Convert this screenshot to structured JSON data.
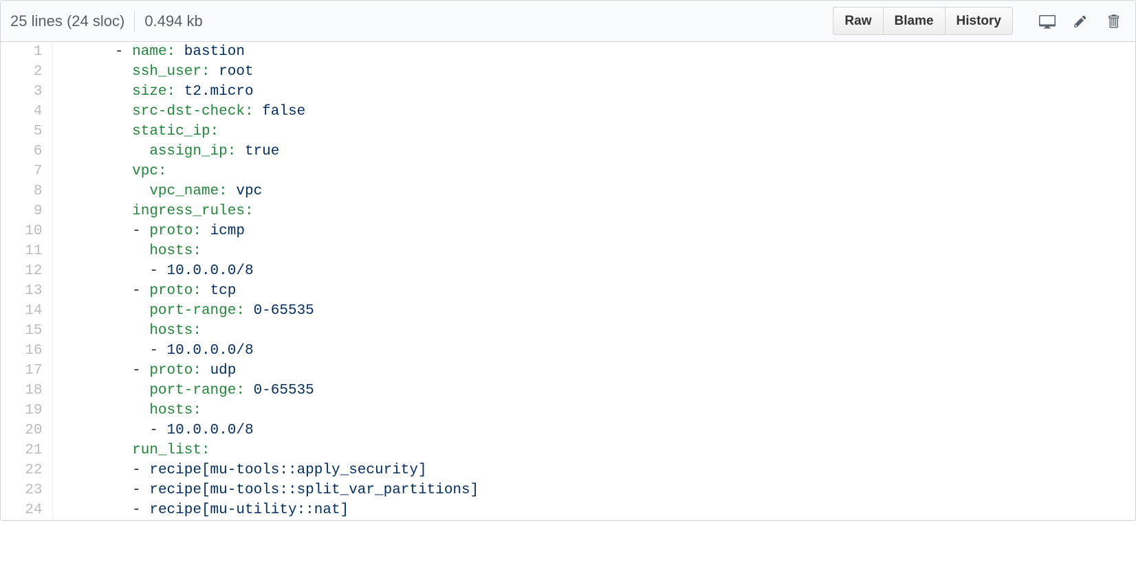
{
  "header": {
    "info_lines": "25 lines (24 sloc)",
    "info_size": "0.494 kb",
    "raw_label": "Raw",
    "blame_label": "Blame",
    "history_label": "History"
  },
  "code": {
    "lines": [
      {
        "n": 1,
        "indent": "    ",
        "dash": "- ",
        "key": "name: ",
        "val": "bastion",
        "tail": ""
      },
      {
        "n": 2,
        "indent": "      ",
        "dash": "",
        "key": "ssh_user: ",
        "val": "root",
        "tail": ""
      },
      {
        "n": 3,
        "indent": "      ",
        "dash": "",
        "key": "size: ",
        "val": "t2.micro",
        "tail": ""
      },
      {
        "n": 4,
        "indent": "      ",
        "dash": "",
        "key": "src-dst-check: ",
        "val": "false",
        "tail": ""
      },
      {
        "n": 5,
        "indent": "      ",
        "dash": "",
        "key": "static_ip:",
        "val": "",
        "tail": ""
      },
      {
        "n": 6,
        "indent": "        ",
        "dash": "",
        "key": "assign_ip: ",
        "val": "true",
        "tail": ""
      },
      {
        "n": 7,
        "indent": "      ",
        "dash": "",
        "key": "vpc:",
        "val": "",
        "tail": ""
      },
      {
        "n": 8,
        "indent": "        ",
        "dash": "",
        "key": "vpc_name: ",
        "val": "vpc",
        "tail": ""
      },
      {
        "n": 9,
        "indent": "      ",
        "dash": "",
        "key": "ingress_rules:",
        "val": "",
        "tail": ""
      },
      {
        "n": 10,
        "indent": "      ",
        "dash": "- ",
        "key": "proto: ",
        "val": "icmp",
        "tail": ""
      },
      {
        "n": 11,
        "indent": "        ",
        "dash": "",
        "key": "hosts:",
        "val": "",
        "tail": ""
      },
      {
        "n": 12,
        "indent": "        ",
        "dash": "- ",
        "key": "",
        "val": "10.0.0.0/8",
        "tail": ""
      },
      {
        "n": 13,
        "indent": "      ",
        "dash": "- ",
        "key": "proto: ",
        "val": "tcp",
        "tail": ""
      },
      {
        "n": 14,
        "indent": "        ",
        "dash": "",
        "key": "port-range: ",
        "val": "0-65535",
        "tail": ""
      },
      {
        "n": 15,
        "indent": "        ",
        "dash": "",
        "key": "hosts:",
        "val": "",
        "tail": ""
      },
      {
        "n": 16,
        "indent": "        ",
        "dash": "- ",
        "key": "",
        "val": "10.0.0.0/8",
        "tail": ""
      },
      {
        "n": 17,
        "indent": "      ",
        "dash": "- ",
        "key": "proto: ",
        "val": "udp",
        "tail": ""
      },
      {
        "n": 18,
        "indent": "        ",
        "dash": "",
        "key": "port-range: ",
        "val": "0-65535",
        "tail": ""
      },
      {
        "n": 19,
        "indent": "        ",
        "dash": "",
        "key": "hosts:",
        "val": "",
        "tail": ""
      },
      {
        "n": 20,
        "indent": "        ",
        "dash": "- ",
        "key": "",
        "val": "10.0.0.0/8",
        "tail": ""
      },
      {
        "n": 21,
        "indent": "      ",
        "dash": "",
        "key": "run_list:",
        "val": "",
        "tail": ""
      },
      {
        "n": 22,
        "indent": "      ",
        "dash": "- ",
        "key": "",
        "val": "recipe[mu-tools::apply_security]",
        "tail": ""
      },
      {
        "n": 23,
        "indent": "      ",
        "dash": "- ",
        "key": "",
        "val": "recipe[mu-tools::split_var_partitions]",
        "tail": ""
      },
      {
        "n": 24,
        "indent": "      ",
        "dash": "- ",
        "key": "",
        "val": "recipe[mu-utility::nat]",
        "tail": ""
      }
    ]
  }
}
